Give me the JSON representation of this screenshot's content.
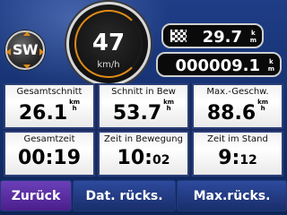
{
  "compass": {
    "heading": "SW",
    "accent": "#e08a1a"
  },
  "speedometer": {
    "value": "47",
    "unit": "km/h"
  },
  "trip": {
    "icon": "checkered-flag-icon",
    "value": "29.7",
    "unit_top": "k",
    "unit_bottom": "m"
  },
  "odometer": {
    "value": "000009.1",
    "unit_top": "k",
    "unit_bottom": "m"
  },
  "cells": [
    {
      "label": "Gesamtschnitt",
      "main": "26.1",
      "sub": "",
      "unit_top": "km",
      "unit_bottom": "h"
    },
    {
      "label": "Schnitt in Bew",
      "main": "53.7",
      "sub": "",
      "unit_top": "km",
      "unit_bottom": "h"
    },
    {
      "label": "Max.-Geschw.",
      "main": "88.6",
      "sub": "",
      "unit_top": "km",
      "unit_bottom": "h"
    },
    {
      "label": "Gesamtzeit",
      "main": "00:19",
      "sub": "",
      "unit_top": "",
      "unit_bottom": ""
    },
    {
      "label": "Zeit in Bewegung",
      "main": "10:",
      "sub": "02",
      "unit_top": "",
      "unit_bottom": ""
    },
    {
      "label": "Zeit im Stand",
      "main": "9:",
      "sub": "12",
      "unit_top": "",
      "unit_bottom": ""
    }
  ],
  "buttons": {
    "back": "Zurück",
    "reset_data": "Dat. rücks.",
    "reset_max": "Max.rücks."
  }
}
